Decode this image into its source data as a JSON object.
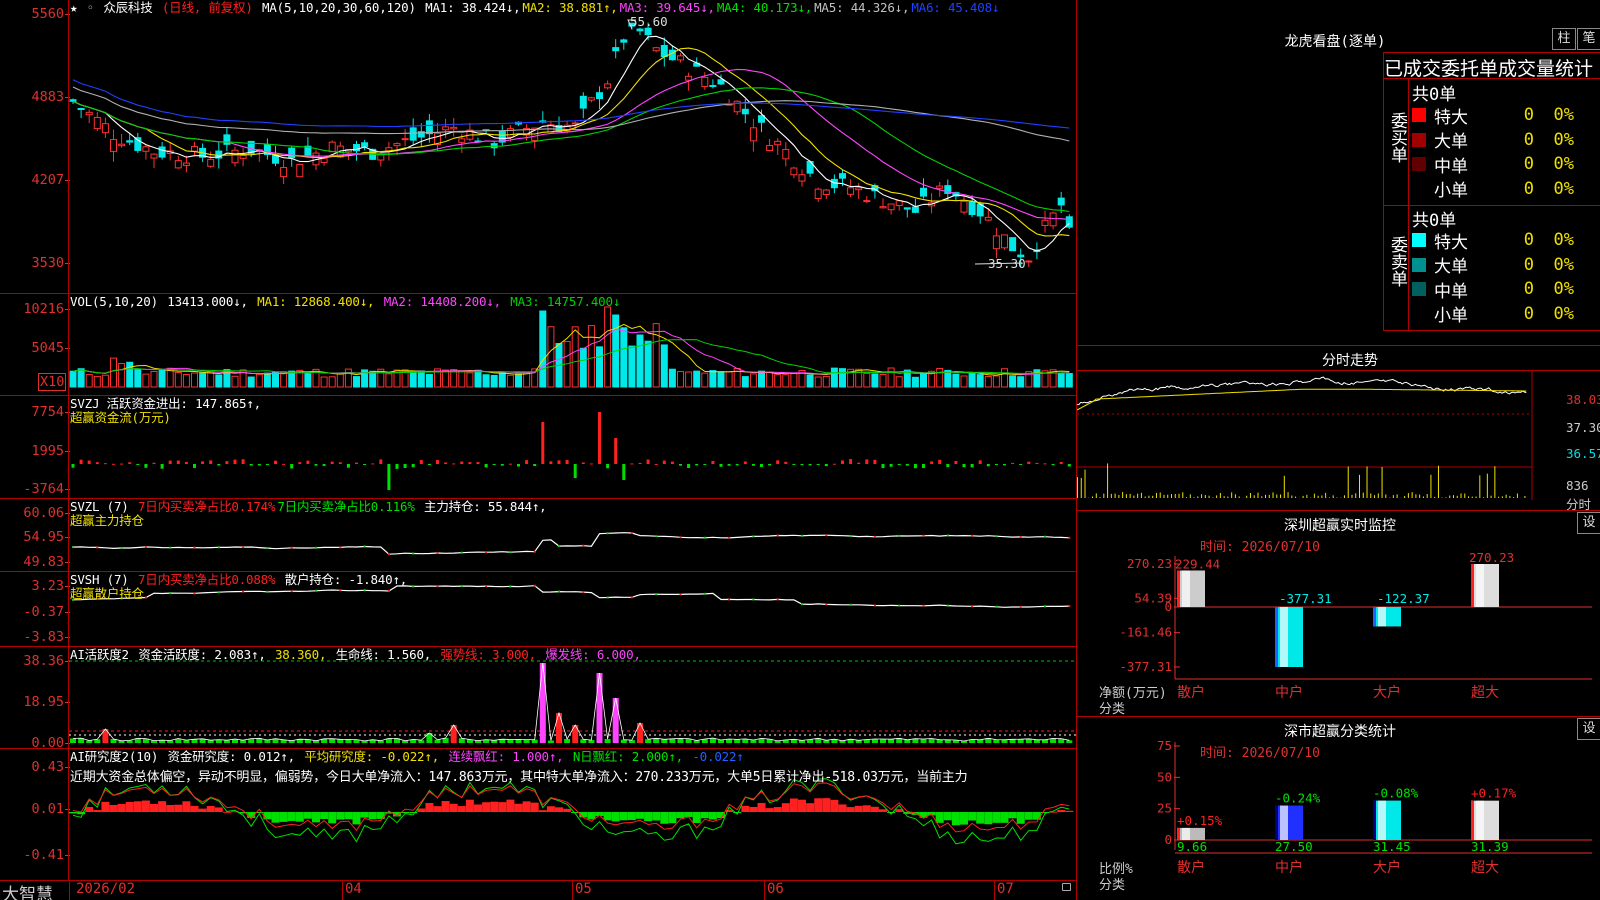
{
  "brand": "大智慧",
  "stock_name": "众辰科技",
  "period_label": "(日线, 前复权)",
  "ma_header": {
    "label": "MA(5,10,20,30,60,120)",
    "items": [
      {
        "label": "MA1:",
        "value": "38.424",
        "arrow": "↓",
        "color": "#ffffff"
      },
      {
        "label": "MA2:",
        "value": "38.881",
        "arrow": "↑",
        "color": "#f0e000"
      },
      {
        "label": "MA3:",
        "value": "39.645",
        "arrow": "↓",
        "color": "#ff44ff"
      },
      {
        "label": "MA4:",
        "value": "40.173",
        "arrow": "↓",
        "color": "#00e000"
      },
      {
        "label": "MA5:",
        "value": "44.326",
        "arrow": "↓",
        "color": "#c0c0c0"
      },
      {
        "label": "MA6:",
        "value": "45.408",
        "arrow": "↓",
        "color": "#2040ff"
      }
    ]
  },
  "price_axis": [
    "5560",
    "4883",
    "4207",
    "3530"
  ],
  "price_annotations": {
    "high": "55.60",
    "low": "35.30"
  },
  "vol_header": {
    "label": "VOL(5,10,20)",
    "value": "13413.000↓,",
    "ma1": "MA1: 12868.400↓,",
    "ma2": "MA2: 14408.200↓,",
    "ma3": "MA3: 14757.400↓"
  },
  "vol_axis": [
    "10216",
    "5045",
    "X10"
  ],
  "svzj": {
    "line1": "SVZJ  活跃资金进出: 147.865↑,",
    "line2": "超赢资金流(万元)",
    "axis": [
      "7754",
      "1995",
      "-3764"
    ]
  },
  "svzl": {
    "prefix": "SVZL (7)",
    "red": "7日内买卖净占比0.174%",
    "green": "7日内买卖净占比0.116%",
    "white": "主力持仓: 55.844↑,",
    "line2": "超赢主力持仓",
    "axis": [
      "60.06",
      "54.95",
      "49.83"
    ]
  },
  "svsh": {
    "prefix": "SVSH (7)",
    "red": "7日内买卖净占比0.088%",
    "white": "散户持仓: -1.840↑,",
    "line2": "超赢散户持仓",
    "axis": [
      "3.23",
      "-0.37",
      "-3.83"
    ]
  },
  "ai_active": {
    "prefix": "AI活跃度2",
    "a": "资金活跃度: 2.083↑,",
    "b": "38.360,",
    "c": "生命线: 1.560,",
    "d": "强势线: 3.000,",
    "e": "爆发线: 6.000,",
    "axis": [
      "38.36",
      "18.95",
      "0.00"
    ]
  },
  "ai_research": {
    "prefix": "AI研究度2(10)",
    "a": "资金研究度: 0.012↑,",
    "b": "平均研究度: -0.022↑,",
    "c": "连续飘红: 1.000↑,",
    "d": "N日飘红: 2.000↑,",
    "e": "-0.022↑",
    "summary": "近期大资金总体偏空，异动不明显，偏弱势，今日大单净流入：147.863万元，其中特大单净流入：270.233万元，大单5日累计净出-518.03万元，当前主力",
    "axis": [
      "0.43",
      "0.01",
      "-0.41"
    ]
  },
  "x_axis": [
    {
      "label": "2026/02"
    },
    {
      "label": "04"
    },
    {
      "label": "05"
    },
    {
      "label": "06"
    },
    {
      "label": "07"
    }
  ],
  "longhu": {
    "title": "龙虎看盘(逐单)",
    "btn1": "柱",
    "btn2": "笔",
    "stat_title": "已成交委托单成交量统计",
    "buy_title": "委买单",
    "sell_title": "委卖单",
    "buy_total": "共0单",
    "sell_total": "共0单",
    "buy_rows": [
      {
        "label": "特大",
        "count": "0",
        "pct": "0%",
        "color": "#ff0000"
      },
      {
        "label": "大单",
        "count": "0",
        "pct": "0%",
        "color": "#a00000"
      },
      {
        "label": "中单",
        "count": "0",
        "pct": "0%",
        "color": "#600000"
      },
      {
        "label": "小单",
        "count": "0",
        "pct": "0%",
        "color": "#000000"
      }
    ],
    "sell_rows": [
      {
        "label": "特大",
        "count": "0",
        "pct": "0%",
        "color": "#00ffff"
      },
      {
        "label": "大单",
        "count": "0",
        "pct": "0%",
        "color": "#009090"
      },
      {
        "label": "中单",
        "count": "0",
        "pct": "0%",
        "color": "#006060"
      },
      {
        "label": "小单",
        "count": "0",
        "pct": "0%",
        "color": "#000000"
      }
    ]
  },
  "intraday": {
    "title": "分时走势",
    "axis": [
      "38.03",
      "37.30",
      "36.57",
      "836",
      "分时"
    ]
  },
  "monitor1": {
    "title": "深圳超赢实时监控",
    "btn": "设",
    "time": "时间: 2026/07/10",
    "axis": [
      "270.23",
      "54.39",
      "0",
      "-161.46",
      "-377.31"
    ],
    "ylabel1": "净额(万元)",
    "ylabel2": "分类",
    "bars": [
      {
        "category": "散户",
        "value": 229.44,
        "label": "229.44"
      },
      {
        "category": "中户",
        "value": -377.31,
        "label": "-377.31"
      },
      {
        "category": "大户",
        "value": -122.37,
        "label": "-122.37"
      },
      {
        "category": "超大",
        "value": 270.23,
        "label": "270.23"
      }
    ]
  },
  "monitor2": {
    "title": "深市超赢分类统计",
    "btn": "设",
    "time": "时间: 2026/07/10",
    "axis": [
      "75",
      "50",
      "25",
      "0"
    ],
    "ylabel1": "比例%",
    "ylabel2": "分类",
    "bars": [
      {
        "category": "散户",
        "value": 9.66,
        "label": "9.66",
        "change": "+0.15%"
      },
      {
        "category": "中户",
        "value": 27.5,
        "label": "27.50",
        "change": "-0.24%"
      },
      {
        "category": "大户",
        "value": 31.45,
        "label": "31.45",
        "change": "-0.08%"
      },
      {
        "category": "超大",
        "value": 31.39,
        "label": "31.39",
        "change": "+0.17%"
      }
    ]
  },
  "colors": {
    "up": "#ff3030",
    "down": "#00e8e8",
    "border": "#b00000",
    "ma_white": "#ffffff",
    "ma_yellow": "#f0e000",
    "ma_magenta": "#ff44ff",
    "ma_green": "#00d000",
    "ma_gray": "#b0b0b0",
    "ma_blue": "#2040ff"
  }
}
